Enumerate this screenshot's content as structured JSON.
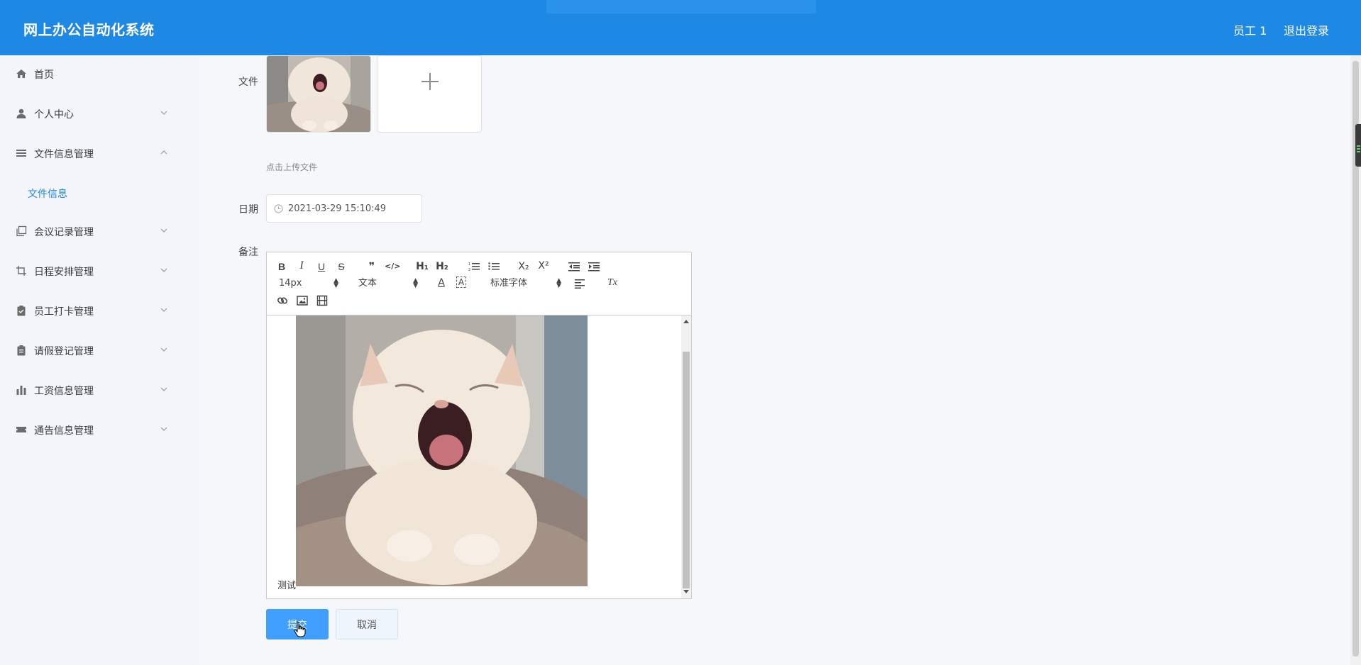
{
  "header": {
    "title": "网上办公自动化系统",
    "user": "员工 1",
    "logout": "退出登录"
  },
  "sidebar": {
    "items": [
      {
        "label": "首页",
        "icon": "home-icon"
      },
      {
        "label": "个人中心",
        "icon": "user-icon"
      },
      {
        "label": "文件信息管理",
        "icon": "list-icon"
      },
      {
        "label": "文件信息",
        "sub": true
      },
      {
        "label": "会议记录管理",
        "icon": "copy-icon"
      },
      {
        "label": "日程安排管理",
        "icon": "crop-icon"
      },
      {
        "label": "员工打卡管理",
        "icon": "clipboard-check-icon"
      },
      {
        "label": "请假登记管理",
        "icon": "clipboard-icon"
      },
      {
        "label": "工资信息管理",
        "icon": "bar-chart-icon"
      },
      {
        "label": "通告信息管理",
        "icon": "ticket-icon"
      }
    ]
  },
  "form": {
    "file_label": "文件",
    "upload_tip": "点击上传文件",
    "date_label": "日期",
    "date_value": "2021-03-29 15:10:49",
    "remark_label": "备注",
    "editor": {
      "font_size": "14px",
      "block_type": "文本",
      "font_family": "标准字体",
      "content_text": "测试",
      "toolbar": {
        "bold": "B",
        "italic": "I",
        "underline": "U",
        "strike": "S",
        "quote": "❞",
        "code": "</>",
        "h1": "H₁",
        "h2": "H₂",
        "sub": "X₂",
        "sup": "X²",
        "color": "A",
        "bg": "A",
        "clear": "Tx"
      }
    },
    "submit": "提交",
    "cancel": "取消"
  },
  "colors": {
    "header_bg": "#1e88e5",
    "accent": "#409eff",
    "sidebar_bg": "#f3f5fa"
  }
}
